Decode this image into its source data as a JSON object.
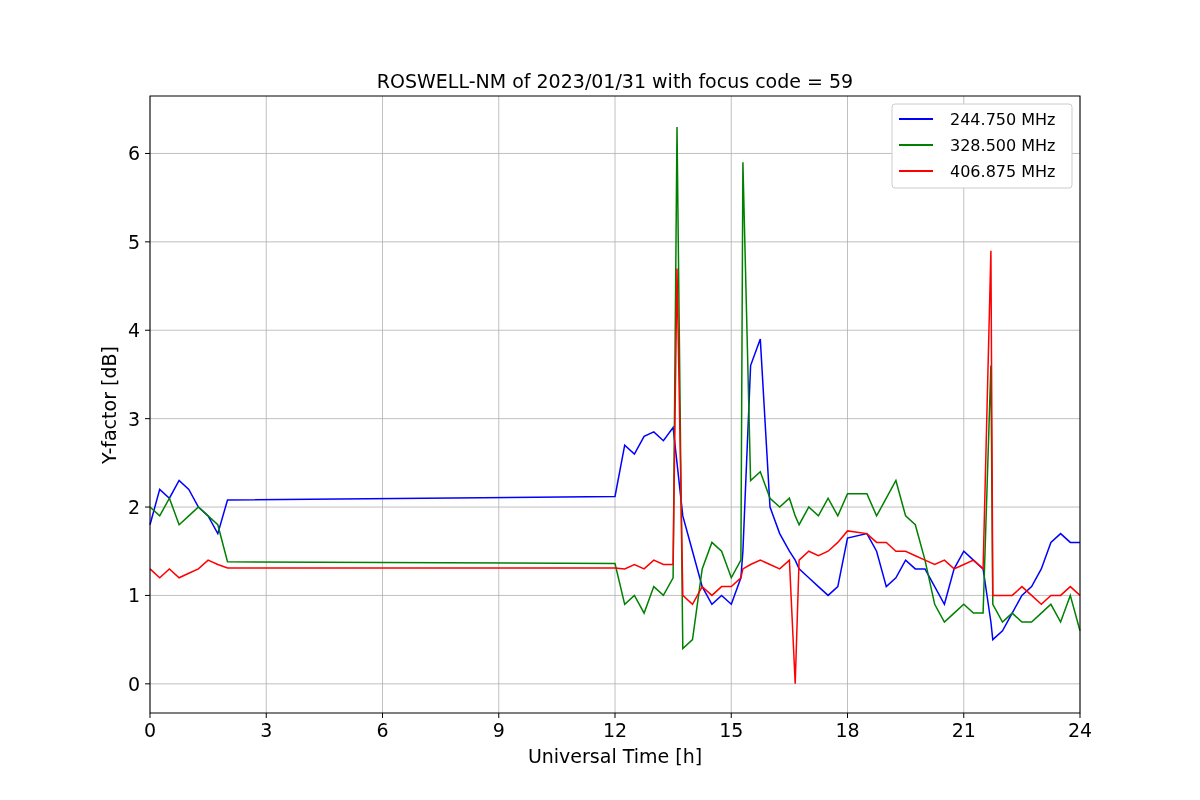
{
  "chart": {
    "chart_data": {
      "type": "line",
      "title": "ROSWELL-NM of 2023/01/31 with focus code = 59",
      "xlabel": "Universal Time [h]",
      "ylabel": "Y-factor [dB]",
      "x": [
        0,
        0.25,
        0.5,
        0.75,
        1,
        1.25,
        1.5,
        1.75,
        2,
        12,
        12.25,
        12.5,
        12.75,
        13,
        13.25,
        13.5,
        13.6,
        13.75,
        14,
        14.25,
        14.5,
        14.75,
        15,
        15.25,
        15.3,
        15.5,
        15.75,
        16,
        16.25,
        16.5,
        16.65,
        16.75,
        17,
        17.25,
        17.5,
        17.75,
        18,
        18.5,
        18.75,
        19,
        19.25,
        19.5,
        19.75,
        20,
        20.25,
        20.5,
        20.75,
        21,
        21.25,
        21.5,
        21.7,
        21.75,
        22,
        22.25,
        22.5,
        22.75,
        23,
        23.25,
        23.5,
        23.75,
        24
      ],
      "series": [
        {
          "name": "244.750 MHz",
          "color": "#0000ff",
          "values": [
            1.8,
            2.2,
            2.1,
            2.3,
            2.2,
            2.0,
            1.9,
            1.7,
            2.08,
            2.12,
            2.7,
            2.6,
            2.8,
            2.85,
            2.75,
            2.9,
            2.5,
            1.9,
            1.5,
            1.1,
            0.9,
            1.0,
            0.9,
            1.2,
            1.5,
            3.6,
            3.9,
            2.0,
            1.7,
            1.5,
            1.4,
            1.3,
            1.2,
            1.1,
            1.0,
            1.1,
            1.65,
            1.7,
            1.5,
            1.1,
            1.2,
            1.4,
            1.3,
            1.3,
            1.1,
            0.9,
            1.3,
            1.5,
            1.4,
            1.3,
            0.7,
            0.5,
            0.6,
            0.8,
            1.0,
            1.1,
            1.3,
            1.6,
            1.7,
            1.6,
            1.6
          ]
        },
        {
          "name": "328.500 MHz",
          "color": "#008000",
          "values": [
            2.0,
            1.9,
            2.1,
            1.8,
            1.9,
            2.0,
            1.9,
            1.8,
            1.38,
            1.36,
            0.9,
            1.0,
            0.8,
            1.1,
            1.0,
            1.2,
            6.3,
            0.4,
            0.5,
            1.3,
            1.6,
            1.5,
            1.2,
            1.4,
            5.9,
            2.3,
            2.4,
            2.1,
            2.0,
            2.1,
            1.9,
            1.8,
            2.0,
            1.9,
            2.1,
            1.9,
            2.15,
            2.15,
            1.9,
            2.1,
            2.3,
            1.9,
            1.8,
            1.4,
            0.9,
            0.7,
            0.8,
            0.9,
            0.8,
            0.8,
            3.6,
            0.9,
            0.7,
            0.8,
            0.7,
            0.7,
            0.8,
            0.9,
            0.7,
            1.0,
            0.6
          ]
        },
        {
          "name": "406.875 MHz",
          "color": "#ff0000",
          "values": [
            1.3,
            1.2,
            1.3,
            1.2,
            1.25,
            1.3,
            1.4,
            1.35,
            1.31,
            1.31,
            1.3,
            1.35,
            1.3,
            1.4,
            1.35,
            1.35,
            4.7,
            1.0,
            0.9,
            1.1,
            1.0,
            1.1,
            1.1,
            1.2,
            1.3,
            1.35,
            1.4,
            1.35,
            1.3,
            1.4,
            0.0,
            1.4,
            1.5,
            1.45,
            1.5,
            1.6,
            1.73,
            1.7,
            1.6,
            1.6,
            1.5,
            1.5,
            1.45,
            1.4,
            1.35,
            1.4,
            1.3,
            1.35,
            1.4,
            1.3,
            4.9,
            1.0,
            1.0,
            1.0,
            1.1,
            1.0,
            0.9,
            1.0,
            1.0,
            1.1,
            1.0
          ]
        }
      ],
      "grid": true,
      "legend": true,
      "xlim": [
        0,
        24
      ],
      "ylim": [
        -0.33,
        6.65
      ],
      "xticks": [
        0,
        3,
        6,
        9,
        12,
        15,
        18,
        21,
        24
      ],
      "yticks": [
        0,
        1,
        2,
        3,
        4,
        5,
        6
      ]
    }
  }
}
